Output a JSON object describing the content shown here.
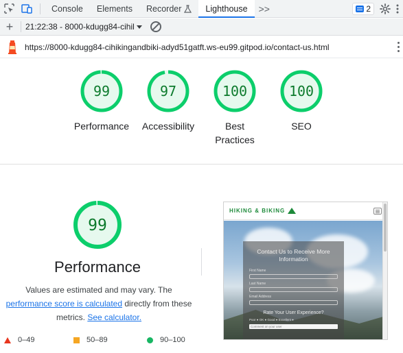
{
  "devtools": {
    "tabs": [
      {
        "label": "Console",
        "active": false
      },
      {
        "label": "Elements",
        "active": false
      },
      {
        "label": "Recorder",
        "active": false
      },
      {
        "label": "Lighthouse",
        "active": true
      }
    ],
    "more_tabs": ">>",
    "issues_count": "2"
  },
  "report": {
    "selected": "21:22:38 - 8000-kdugg84-cihik",
    "url": "https://8000-kdugg84-cihikingandbiki-adyd51gatft.ws-eu99.gitpod.io/contact-us.html"
  },
  "scores": [
    {
      "label": "Performance",
      "value": 99,
      "ring": 0.99
    },
    {
      "label": "Accessibility",
      "value": 97,
      "ring": 0.97
    },
    {
      "label": "Best\nPractices",
      "value": 100,
      "ring": 1.0
    },
    {
      "label": "SEO",
      "value": 100,
      "ring": 1.0
    }
  ],
  "performance": {
    "score": 99,
    "ring": 0.99,
    "title": "Performance",
    "desc_1": "Values are estimated and may vary. The",
    "link_1": "performance score is calculated",
    "desc_2": " directly from these metrics. ",
    "link_2": "See calculator."
  },
  "legend": [
    {
      "label": "0–49",
      "color": "#e8361e"
    },
    {
      "label": "50–89",
      "color": "#f5a623"
    },
    {
      "label": "90–100",
      "color": "#18b663"
    }
  ],
  "thumbnail": {
    "brand": "HIKING & BIKING",
    "form_title": "Contact Us to Receive More Information",
    "first_name": "First Name",
    "last_name": "Last Name",
    "email": "Email Address",
    "rate": "Rate Your User Experience?",
    "radios": "Poor ● OK ● Good ● Excellent ●",
    "comment": "Comment on your user"
  },
  "colors": {
    "pass_green": "#0cce6b",
    "pass_text": "#0c7a2c",
    "pass_fill": "#e6f9ee",
    "active_tab": "#1a73e8"
  }
}
